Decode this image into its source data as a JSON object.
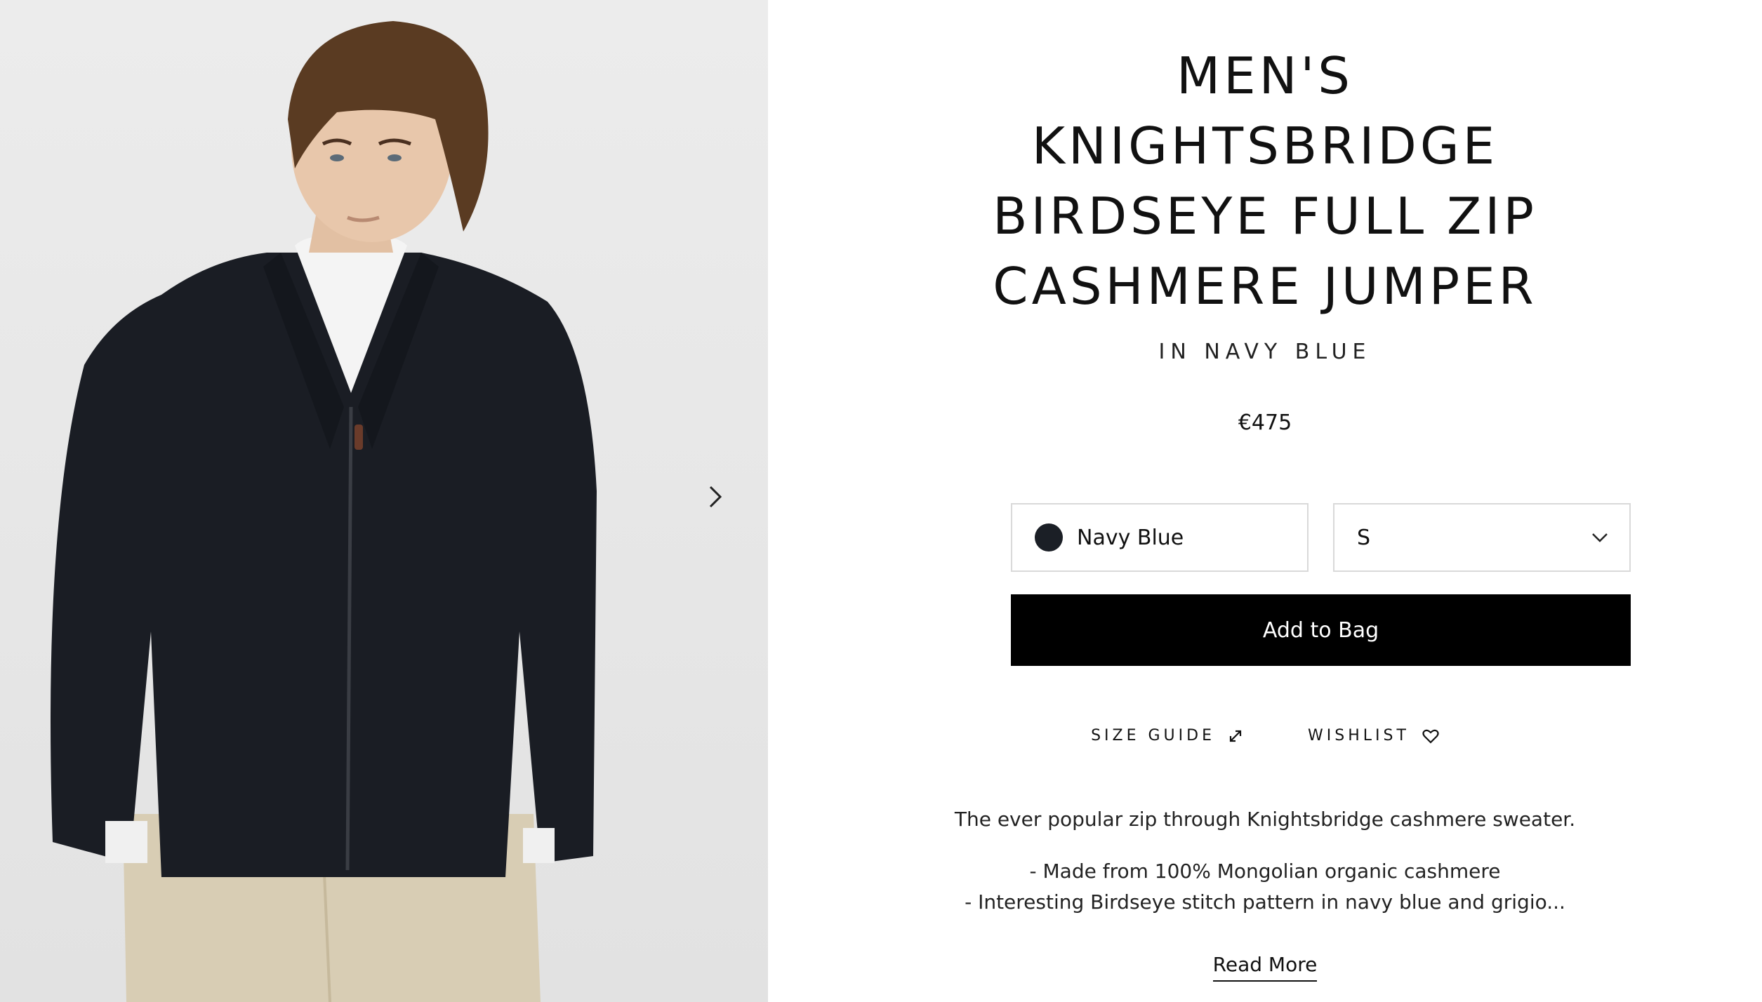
{
  "product": {
    "title_lines": [
      "MEN'S",
      "KNIGHTSBRIDGE",
      "BIRDSEYE FULL ZIP",
      "CASHMERE JUMPER"
    ],
    "subtitle": "IN NAVY BLUE",
    "price": "€475"
  },
  "options": {
    "color_label": "Navy Blue",
    "color_swatch": "#1b1f26",
    "size_value": "S"
  },
  "actions": {
    "add_to_bag": "Add to Bag",
    "size_guide": "SIZE GUIDE",
    "wishlist": "WISHLIST",
    "read_more": "Read More"
  },
  "description": {
    "intro": "The ever popular zip through Knightsbridge cashmere sweater.",
    "bullets": [
      "- Made from 100% Mongolian organic cashmere",
      "- Interesting Birdseye stitch pattern in navy blue and grigio..."
    ]
  },
  "gallery": {
    "image_description": "Model wearing navy zip cashmere jumper"
  }
}
